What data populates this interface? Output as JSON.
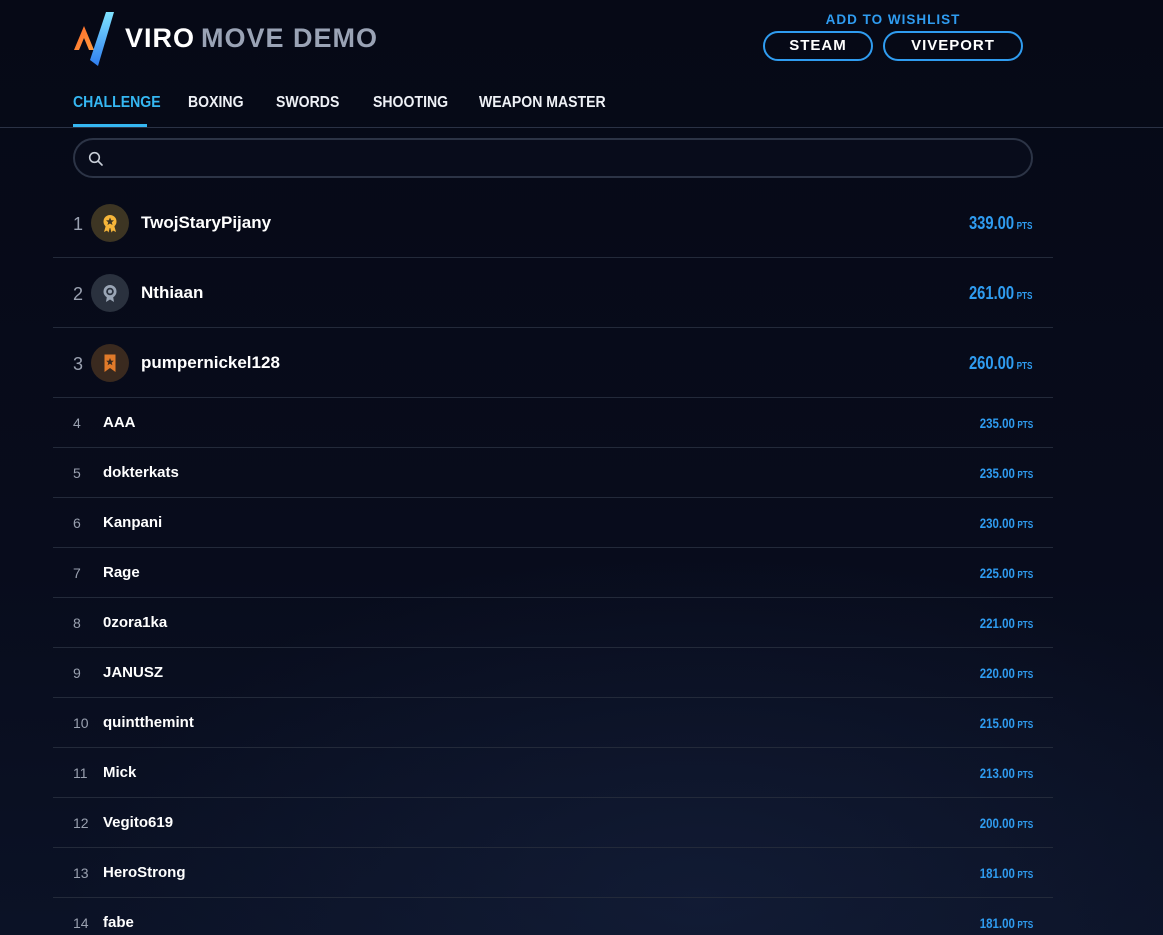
{
  "header": {
    "brand_primary": "VIRO",
    "brand_secondary": "MOVE DEMO",
    "wishlist_label": "ADD TO WISHLIST",
    "steam_label": "STEAM",
    "viveport_label": "VIVEPORT"
  },
  "tabs": [
    {
      "label": "CHALLENGE",
      "active": true
    },
    {
      "label": "BOXING",
      "active": false
    },
    {
      "label": "SWORDS",
      "active": false
    },
    {
      "label": "SHOOTING",
      "active": false
    },
    {
      "label": "WEAPON MASTER",
      "active": false
    }
  ],
  "search": {
    "value": "",
    "placeholder": ""
  },
  "leaderboard": {
    "pts_label": "PTS",
    "rows": [
      {
        "rank": "1",
        "name": "TwojStaryPijany",
        "score": "339.00",
        "medal": "gold-medal-icon"
      },
      {
        "rank": "2",
        "name": "Nthiaan",
        "score": "261.00",
        "medal": "silver-medal-icon"
      },
      {
        "rank": "3",
        "name": "pumpernickel128",
        "score": "260.00",
        "medal": "bronze-medal-icon"
      },
      {
        "rank": "4",
        "name": "AAA",
        "score": "235.00"
      },
      {
        "rank": "5",
        "name": "dokterkats",
        "score": "235.00"
      },
      {
        "rank": "6",
        "name": "Kanpani",
        "score": "230.00"
      },
      {
        "rank": "7",
        "name": "Rage",
        "score": "225.00"
      },
      {
        "rank": "8",
        "name": "0zora1ka",
        "score": "221.00"
      },
      {
        "rank": "9",
        "name": "JANUSZ",
        "score": "220.00"
      },
      {
        "rank": "10",
        "name": "quintthemint",
        "score": "215.00"
      },
      {
        "rank": "11",
        "name": "Mick",
        "score": "213.00"
      },
      {
        "rank": "12",
        "name": "Vegito619",
        "score": "200.00"
      },
      {
        "rank": "13",
        "name": "HeroStrong",
        "score": "181.00"
      },
      {
        "rank": "14",
        "name": "fabe",
        "score": "181.00"
      }
    ]
  },
  "colors": {
    "accent": "#2f9cf0",
    "tab_active": "#35b7f2",
    "background": "#070a17",
    "gold": "#f5b53a",
    "silver": "#9aa5b5",
    "bronze": "#e07a2a"
  }
}
